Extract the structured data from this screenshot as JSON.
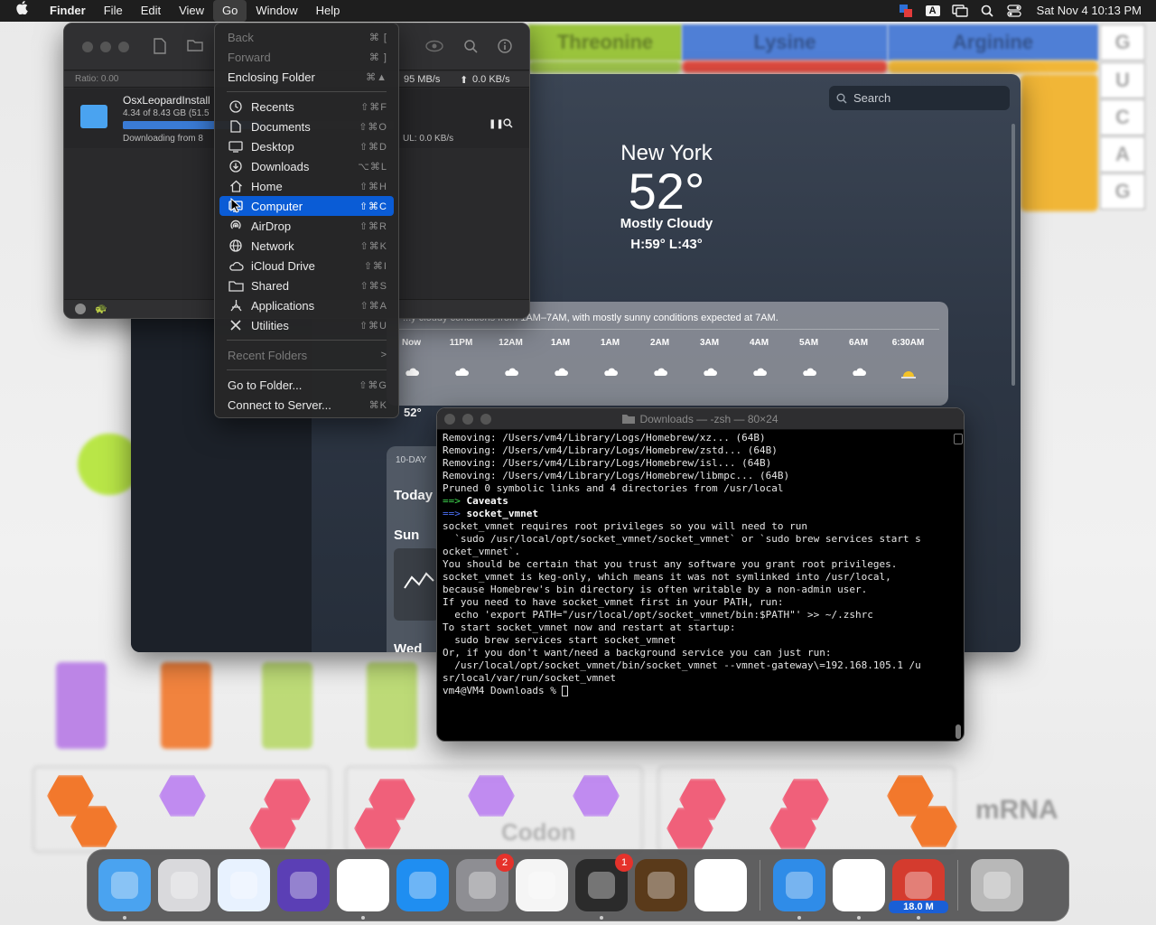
{
  "menubar": {
    "app": "Finder",
    "items": [
      "File",
      "Edit",
      "View",
      "Go",
      "Window",
      "Help"
    ],
    "clock": "Sat Nov 4  10:13 PM",
    "input_source": "A"
  },
  "go_menu": {
    "items": [
      {
        "label": "Back",
        "shortcut": "⌘ [",
        "disabled": true
      },
      {
        "label": "Forward",
        "shortcut": "⌘ ]",
        "disabled": true
      },
      {
        "label": "Enclosing Folder",
        "shortcut": "⌘▲"
      },
      {
        "label": "Recents",
        "shortcut": "⇧⌘F",
        "icon": "clock-icon"
      },
      {
        "label": "Documents",
        "shortcut": "⇧⌘O",
        "icon": "document-icon"
      },
      {
        "label": "Desktop",
        "shortcut": "⇧⌘D",
        "icon": "desktop-icon"
      },
      {
        "label": "Downloads",
        "shortcut": "⌥⌘L",
        "icon": "download-icon"
      },
      {
        "label": "Home",
        "shortcut": "⇧⌘H",
        "icon": "home-icon"
      },
      {
        "label": "Computer",
        "shortcut": "⇧⌘C",
        "icon": "computer-icon",
        "selected": true
      },
      {
        "label": "AirDrop",
        "shortcut": "⇧⌘R",
        "icon": "airdrop-icon"
      },
      {
        "label": "Network",
        "shortcut": "⇧⌘K",
        "icon": "network-icon"
      },
      {
        "label": "iCloud Drive",
        "shortcut": "⇧⌘I",
        "icon": "cloud-icon"
      },
      {
        "label": "Shared",
        "shortcut": "⇧⌘S",
        "icon": "shared-folder-icon"
      },
      {
        "label": "Applications",
        "shortcut": "⇧⌘A",
        "icon": "applications-icon"
      },
      {
        "label": "Utilities",
        "shortcut": "⇧⌘U",
        "icon": "utilities-icon"
      },
      {
        "label": "Recent Folders",
        "shortcut": ">",
        "disabled": true
      },
      {
        "label": "Go to Folder...",
        "shortcut": "⇧⌘G"
      },
      {
        "label": "Connect to Server...",
        "shortcut": "⌘K"
      }
    ]
  },
  "transmission": {
    "ratio": "Ratio: 0.00",
    "down_speed": "95 MB/s",
    "up_speed": "0.0 KB/s",
    "torrent_name": "OsxLeopardInstall",
    "progress_text": "4.34 of 8.43 GB (51.5",
    "progress_fraction": 0.515,
    "status": "Downloading from 8",
    "ul_text": "UL: 0.0 KB/s"
  },
  "weather": {
    "search_placeholder": "Search",
    "city": "New York",
    "temp": "52°",
    "condition": "Mostly Cloudy",
    "hilo": "H:59°  L:43°",
    "summary": "...y cloudy conditions from 1AM–7AM, with mostly sunny conditions expected at 7AM.",
    "hours": [
      "Now",
      "11PM",
      "12AM",
      "1AM",
      "1AM",
      "2AM",
      "3AM",
      "4AM",
      "5AM",
      "6AM",
      "6:30AM"
    ],
    "now_temp": "52°",
    "forecast_label": "10-DAY",
    "day_today": "Today",
    "day_sun": "Sun",
    "day_wed": "Wed"
  },
  "terminal": {
    "title": "Downloads — -zsh — 80×24",
    "lines": [
      "Removing: /Users/vm4/Library/Logs/Homebrew/xz... (64B)",
      "Removing: /Users/vm4/Library/Logs/Homebrew/zstd... (64B)",
      "Removing: /Users/vm4/Library/Logs/Homebrew/isl... (64B)",
      "Removing: /Users/vm4/Library/Logs/Homebrew/libmpc... (64B)",
      "Pruned 0 symbolic links and 4 directories from /usr/local",
      "==> Caveats",
      "==> socket_vmnet",
      "socket_vmnet requires root privileges so you will need to run",
      "  `sudo /usr/local/opt/socket_vmnet/socket_vmnet` or `sudo brew services start s",
      "ocket_vmnet`.",
      "You should be certain that you trust any software you grant root privileges.",
      "",
      "socket_vmnet is keg-only, which means it was not symlinked into /usr/local,",
      "because Homebrew's bin directory is often writable by a non-admin user.",
      "",
      "If you need to have socket_vmnet first in your PATH, run:",
      "  echo 'export PATH=\"/usr/local/opt/socket_vmnet/bin:$PATH\"' >> ~/.zshrc",
      "",
      "To start socket_vmnet now and restart at startup:",
      "  sudo brew services start socket_vmnet",
      "Or, if you don't want/need a background service you can just run:",
      "  /usr/local/opt/socket_vmnet/bin/socket_vmnet --vmnet-gateway\\=192.168.105.1 /u",
      "sr/local/var/run/socket_vmnet",
      "vm4@VM4 Downloads % "
    ]
  },
  "wallpaper": {
    "amino_acids": [
      "Threonine",
      "Lysine",
      "Arginine"
    ],
    "bases": [
      "G",
      "U",
      "C",
      "A",
      "G"
    ],
    "labels": {
      "mrna": "mRNA",
      "codon": "Codon"
    }
  },
  "dock": {
    "apps": [
      {
        "name": "Finder",
        "icon": "finder-icon",
        "color": "#4aa3f0",
        "running": true
      },
      {
        "name": "Launchpad",
        "icon": "launchpad-icon",
        "color": "#d9d9dc"
      },
      {
        "name": "Safari",
        "icon": "safari-icon",
        "color": "#e8f2ff"
      },
      {
        "name": "Firefox",
        "icon": "firefox-icon",
        "color": "#5b3fb5"
      },
      {
        "name": "Chrome",
        "icon": "chrome-icon",
        "color": "#ffffff",
        "running": true
      },
      {
        "name": "App Store",
        "icon": "appstore-icon",
        "color": "#1f8ef1"
      },
      {
        "name": "System Settings",
        "icon": "settings-icon",
        "color": "#8e8e93",
        "badge": "2"
      },
      {
        "name": "TextEdit",
        "icon": "textedit-icon",
        "color": "#f5f5f5"
      },
      {
        "name": "Terminal",
        "icon": "terminal-icon",
        "color": "#2b2b2b",
        "badge": "1",
        "running": true
      },
      {
        "name": "GarageBand",
        "icon": "garageband-icon",
        "color": "#5a3a1a"
      },
      {
        "name": "VS Code",
        "icon": "vscode-icon",
        "color": "#ffffff"
      },
      {
        "name": "Weather",
        "icon": "weather-icon",
        "color": "#2f8ce8",
        "running": true
      },
      {
        "name": "Remote Desktop",
        "icon": "remote-desktop-icon",
        "color": "#ffffff",
        "running": true
      },
      {
        "name": "Transmission",
        "icon": "transmission-icon",
        "color": "#d43b2e",
        "running": true,
        "label": "18.0 M"
      },
      {
        "name": "Trash",
        "icon": "trash-icon",
        "color": "#b8b8b8"
      }
    ]
  }
}
